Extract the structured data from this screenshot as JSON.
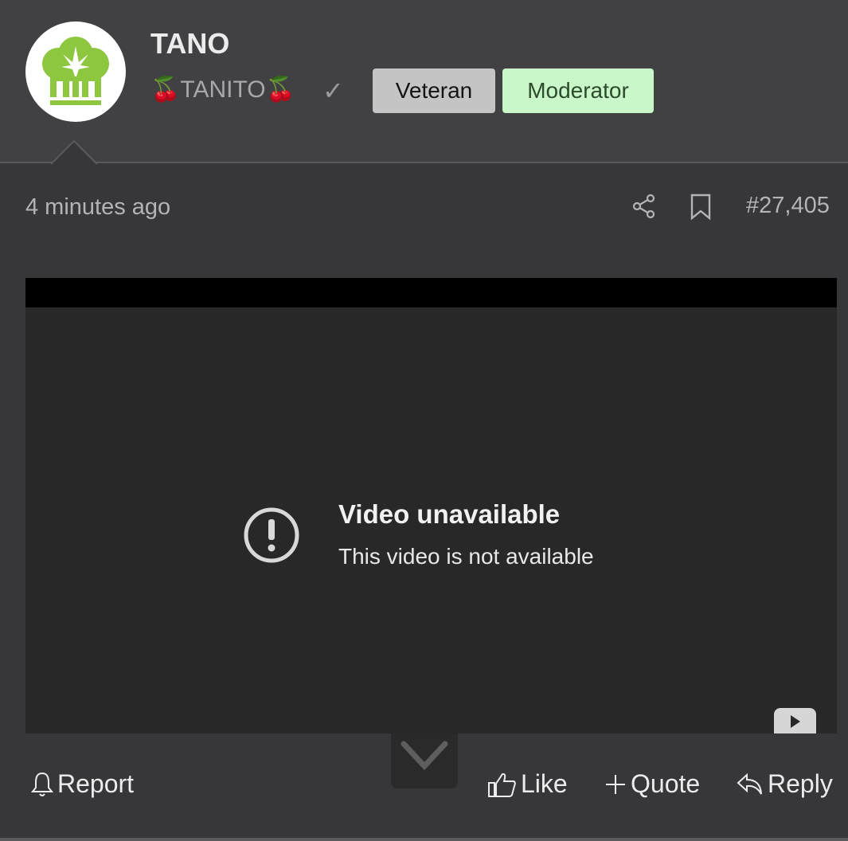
{
  "user": {
    "name": "TANO",
    "title": "🍒TANITO🍒",
    "verified_mark": "✓",
    "badges": [
      "Veteran",
      "Moderator"
    ]
  },
  "post": {
    "time": "4 minutes ago",
    "number": "#27,405"
  },
  "video": {
    "title": "Video unavailable",
    "subtitle": "This video is not available"
  },
  "actions": {
    "report": "Report",
    "like": "Like",
    "quote": "Quote",
    "reply": "Reply"
  },
  "colors": {
    "veteran": "#c4c4c4",
    "moderator": "#c9f7c9",
    "avatar_green": "#8dc63f"
  }
}
